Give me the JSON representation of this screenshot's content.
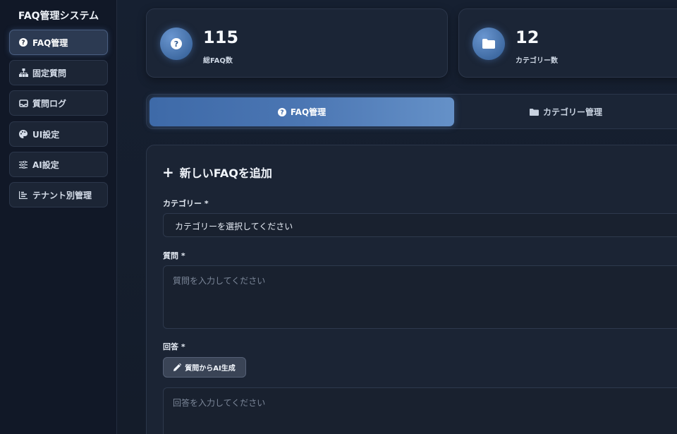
{
  "sidebar": {
    "title": "FAQ管理システム",
    "items": [
      {
        "label": "FAQ管理",
        "icon": "question-circle-icon",
        "active": true
      },
      {
        "label": "固定質問",
        "icon": "sitemap-icon",
        "active": false
      },
      {
        "label": "質問ログ",
        "icon": "inbox-icon",
        "active": false
      },
      {
        "label": "UI設定",
        "icon": "palette-icon",
        "active": false
      },
      {
        "label": "AI設定",
        "icon": "sliders-icon",
        "active": false
      },
      {
        "label": "テナント別管理",
        "icon": "bar-chart-icon",
        "active": false
      }
    ]
  },
  "stats": [
    {
      "value": "115",
      "label": "総FAQ数",
      "icon": "question-circle-icon"
    },
    {
      "value": "12",
      "label": "カテゴリー数",
      "icon": "folder-icon"
    }
  ],
  "tabs": [
    {
      "label": "FAQ管理",
      "icon": "question-circle-icon",
      "active": true
    },
    {
      "label": "カテゴリー管理",
      "icon": "folder-icon",
      "active": false
    }
  ],
  "form": {
    "title": "新しいFAQを追加",
    "category_label": "カテゴリー *",
    "category_value": "カテゴリーを選択してください",
    "question_label": "質問 *",
    "question_placeholder": "質問を入力してください",
    "answer_label": "回答 *",
    "ai_button_label": "質問からAI生成",
    "answer_placeholder": "回答を入力してください"
  },
  "colors": {
    "accent": "#4b76b3",
    "background": "#141c2b",
    "card": "#1b2536"
  }
}
